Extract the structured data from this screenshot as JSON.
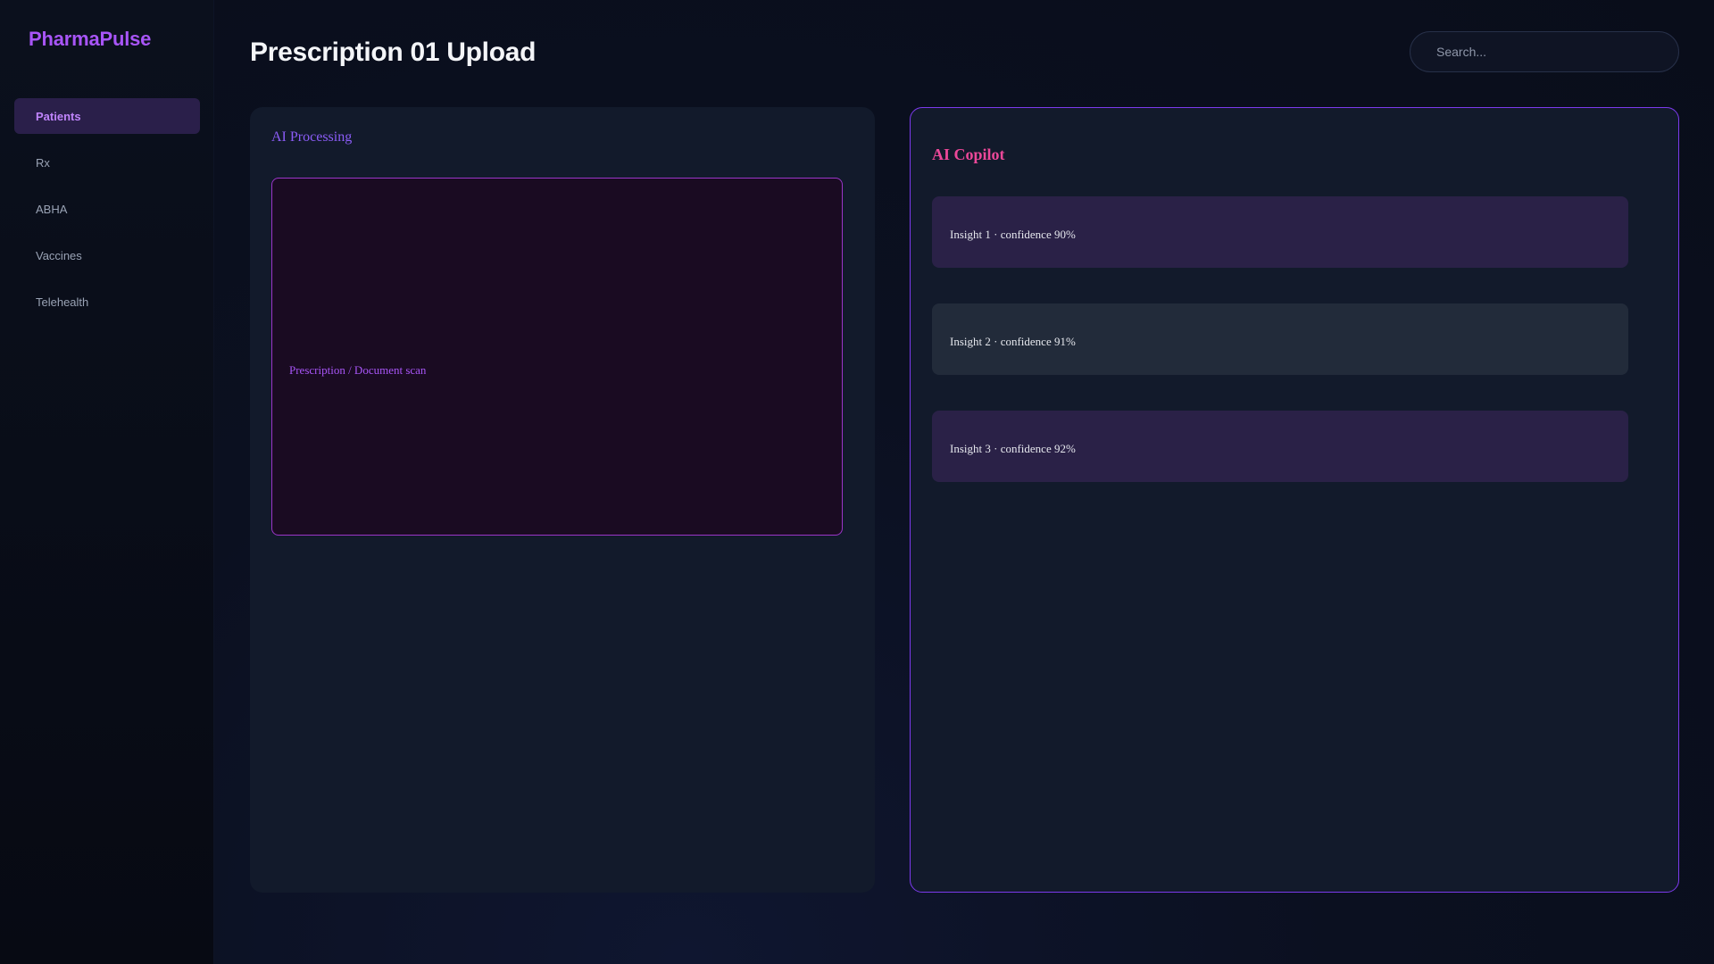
{
  "sidebar": {
    "brand": "PharmaPulse",
    "items": [
      {
        "label": "Patients",
        "active": true
      },
      {
        "label": "Rx"
      },
      {
        "label": "ABHA"
      },
      {
        "label": "Vaccines"
      },
      {
        "label": "Telehealth"
      }
    ]
  },
  "header": {
    "title": "Prescription 01 Upload",
    "search_placeholder": "Search..."
  },
  "processing_panel": {
    "title": "AI Processing",
    "scan_label": "Prescription / Document scan"
  },
  "copilot_panel": {
    "title": "AI Copilot",
    "insights": [
      {
        "text": "Insight 1 · confidence 90%"
      },
      {
        "text": "Insight 2 · confidence 91%"
      },
      {
        "text": "Insight 3 · confidence 92%"
      }
    ]
  },
  "colors": {
    "accent": "#a855f7",
    "copilot_title": "#ec4899",
    "panel_border": "#7c3aed",
    "scan_border": "#9b35c8"
  }
}
